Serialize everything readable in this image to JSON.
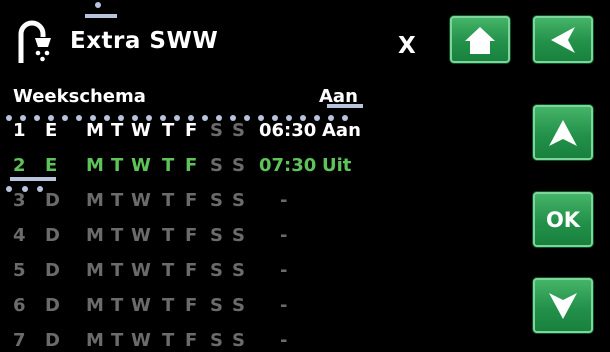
{
  "header": {
    "title": "Extra SWW",
    "close_label": "X",
    "home_icon": "home-icon",
    "back_icon": "back-arrow-icon"
  },
  "schedule": {
    "heading": "Weekschema",
    "status_heading": "Aan",
    "rows": [
      {
        "num": "1",
        "mode": "E",
        "days": [
          "M",
          "T",
          "W",
          "T",
          "F",
          "S",
          "S"
        ],
        "active": [
          1,
          1,
          1,
          1,
          1,
          0,
          0
        ],
        "time": "06:30",
        "state": "Aan",
        "style": "normal"
      },
      {
        "num": "2",
        "mode": "E",
        "days": [
          "M",
          "T",
          "W",
          "T",
          "F",
          "S",
          "S"
        ],
        "active": [
          1,
          1,
          1,
          1,
          1,
          0,
          0
        ],
        "time": "07:30",
        "state": "Uit",
        "style": "selected"
      },
      {
        "num": "3",
        "mode": "D",
        "days": [
          "M",
          "T",
          "W",
          "T",
          "F",
          "S",
          "S"
        ],
        "active": [
          0,
          0,
          0,
          0,
          0,
          0,
          0
        ],
        "time": "-",
        "state": "",
        "style": "disabled"
      },
      {
        "num": "4",
        "mode": "D",
        "days": [
          "M",
          "T",
          "W",
          "T",
          "F",
          "S",
          "S"
        ],
        "active": [
          0,
          0,
          0,
          0,
          0,
          0,
          0
        ],
        "time": "-",
        "state": "",
        "style": "disabled"
      },
      {
        "num": "5",
        "mode": "D",
        "days": [
          "M",
          "T",
          "W",
          "T",
          "F",
          "S",
          "S"
        ],
        "active": [
          0,
          0,
          0,
          0,
          0,
          0,
          0
        ],
        "time": "-",
        "state": "",
        "style": "disabled"
      },
      {
        "num": "6",
        "mode": "D",
        "days": [
          "M",
          "T",
          "W",
          "T",
          "F",
          "S",
          "S"
        ],
        "active": [
          0,
          0,
          0,
          0,
          0,
          0,
          0
        ],
        "time": "-",
        "state": "",
        "style": "disabled"
      },
      {
        "num": "7",
        "mode": "D",
        "days": [
          "M",
          "T",
          "W",
          "T",
          "F",
          "S",
          "S"
        ],
        "active": [
          0,
          0,
          0,
          0,
          0,
          0,
          0
        ],
        "time": "-",
        "state": "",
        "style": "disabled"
      }
    ]
  },
  "controls": {
    "up_icon": "arrow-up-icon",
    "ok_label": "OK",
    "down_icon": "arrow-down-icon"
  },
  "colors": {
    "background": "#000000",
    "text": "#ffffff",
    "selected": "#5ec45a",
    "disabled": "#6b6b6b",
    "button": "#2a9b4f"
  }
}
